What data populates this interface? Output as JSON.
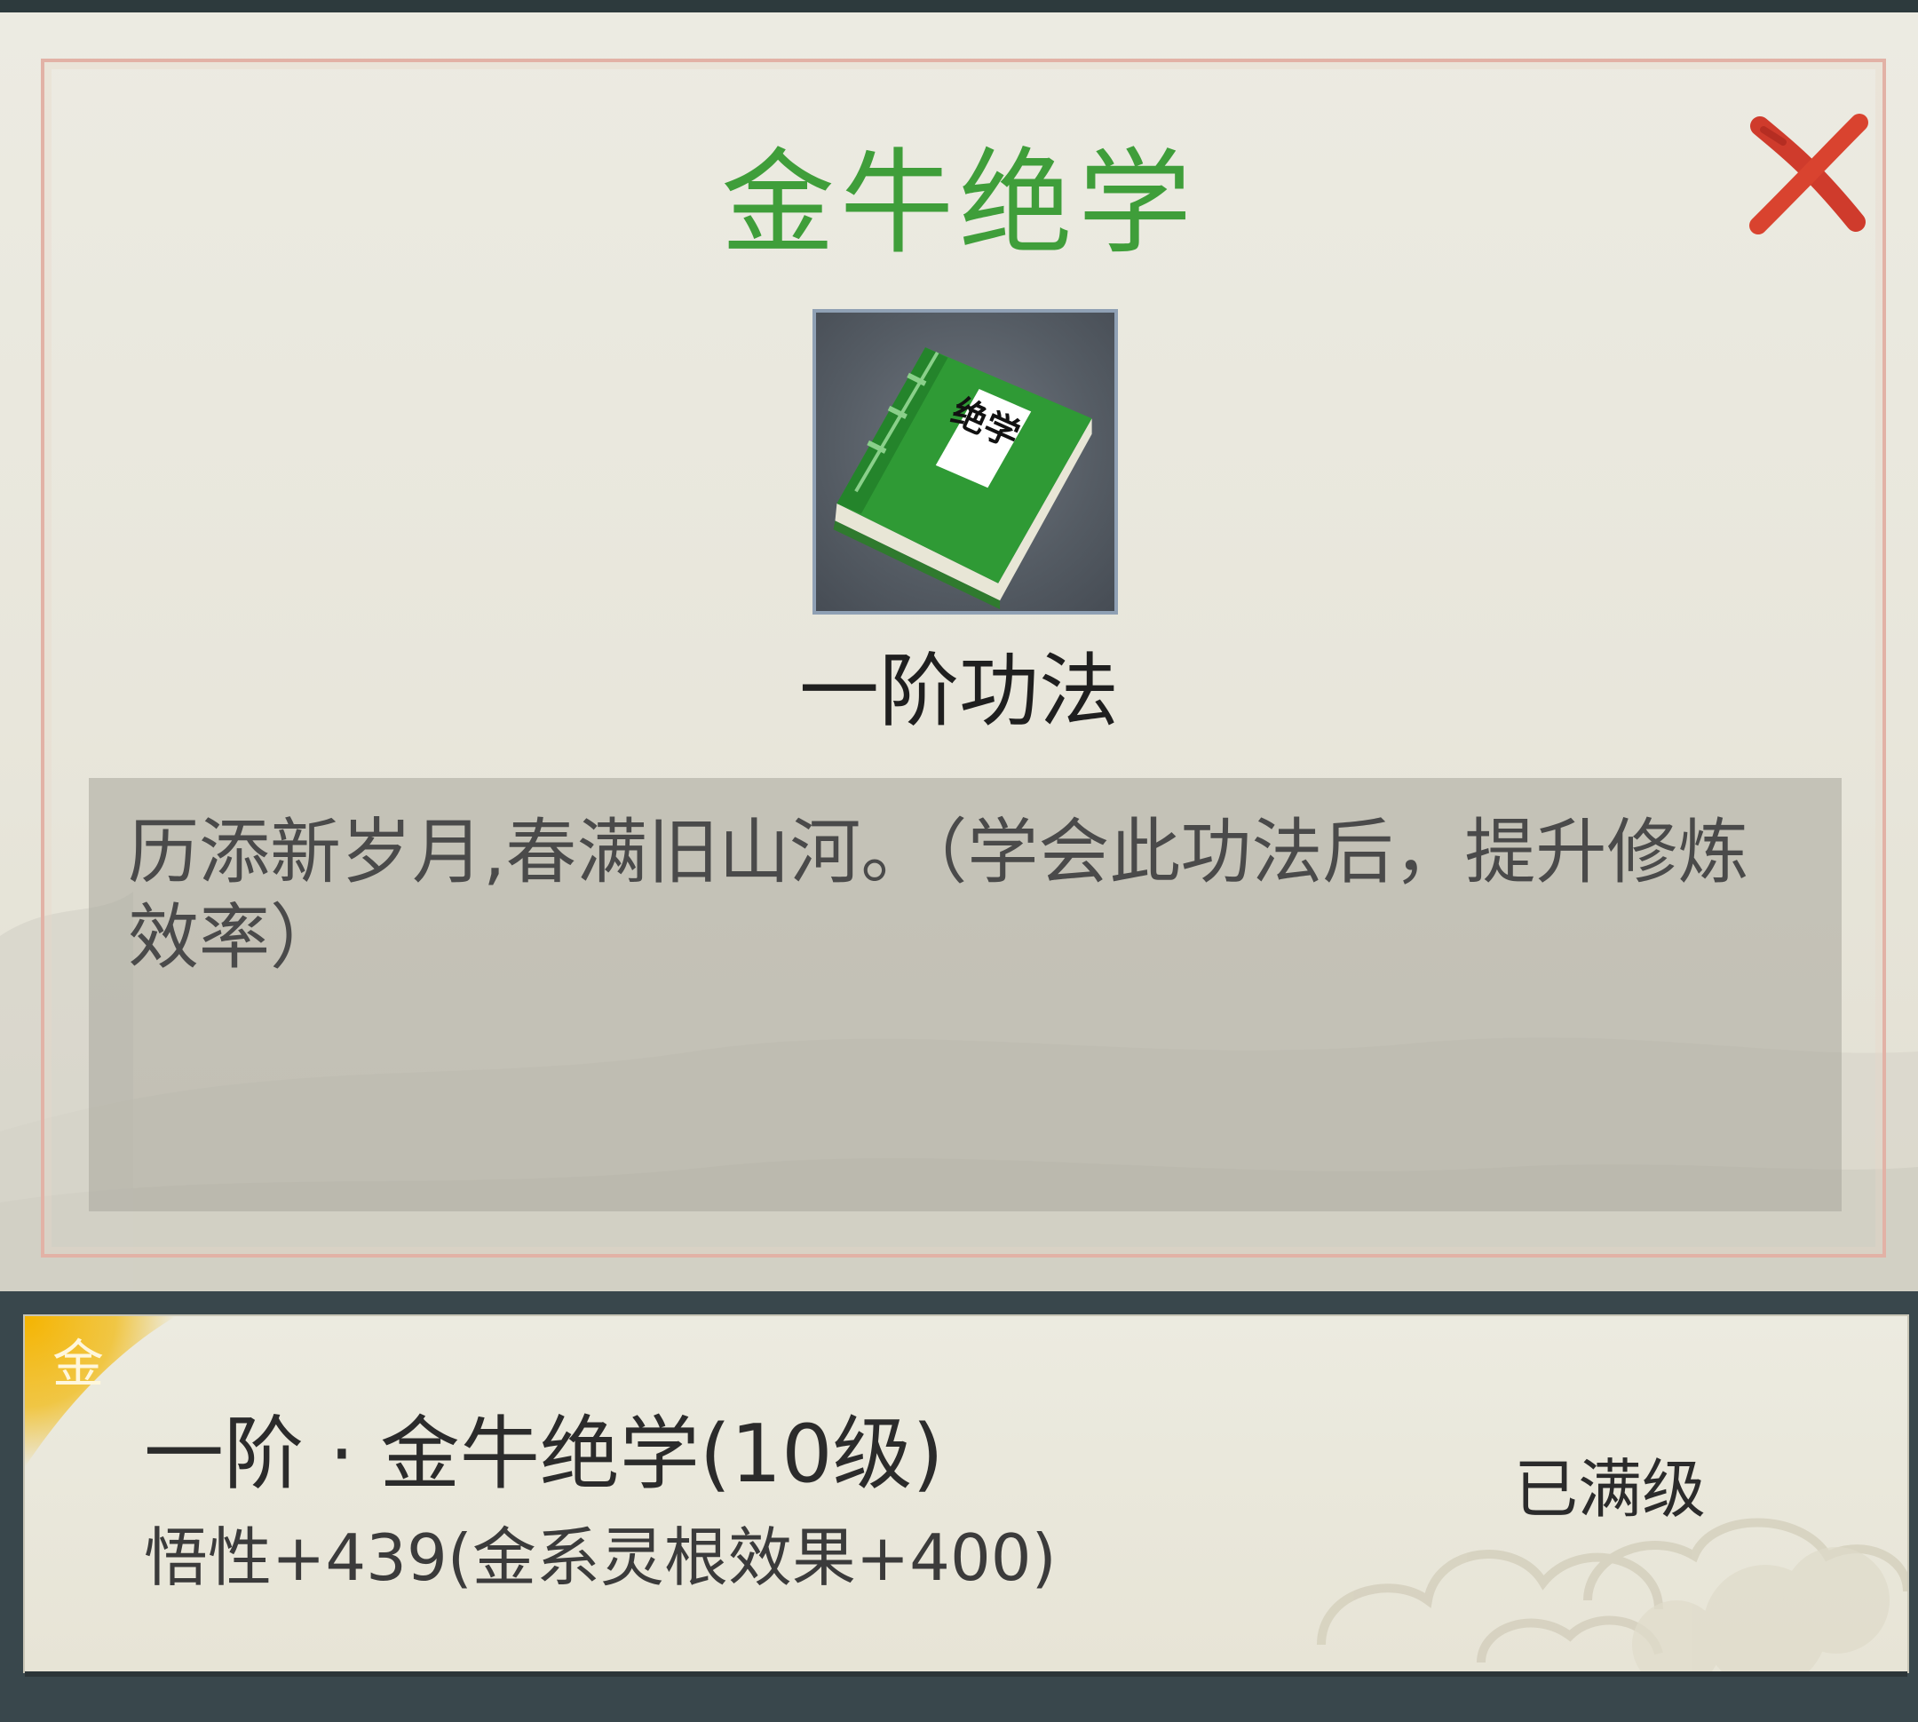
{
  "dialog": {
    "title": "金牛绝学",
    "title_color": "#3f9e3a",
    "item_icon": "green-book-icon",
    "item_icon_label": "绝学",
    "subtitle": "一阶功法",
    "description": "历添新岁月,春满旧山河。（学会此功法后，提升修炼效率）",
    "close_icon": "red-x-close-icon"
  },
  "info_panel": {
    "element_badge": "金",
    "skill_name": "一阶 · 金牛绝学(10级)",
    "bonus": "悟性+439(金系灵根效果+400)",
    "status": "已满级"
  }
}
